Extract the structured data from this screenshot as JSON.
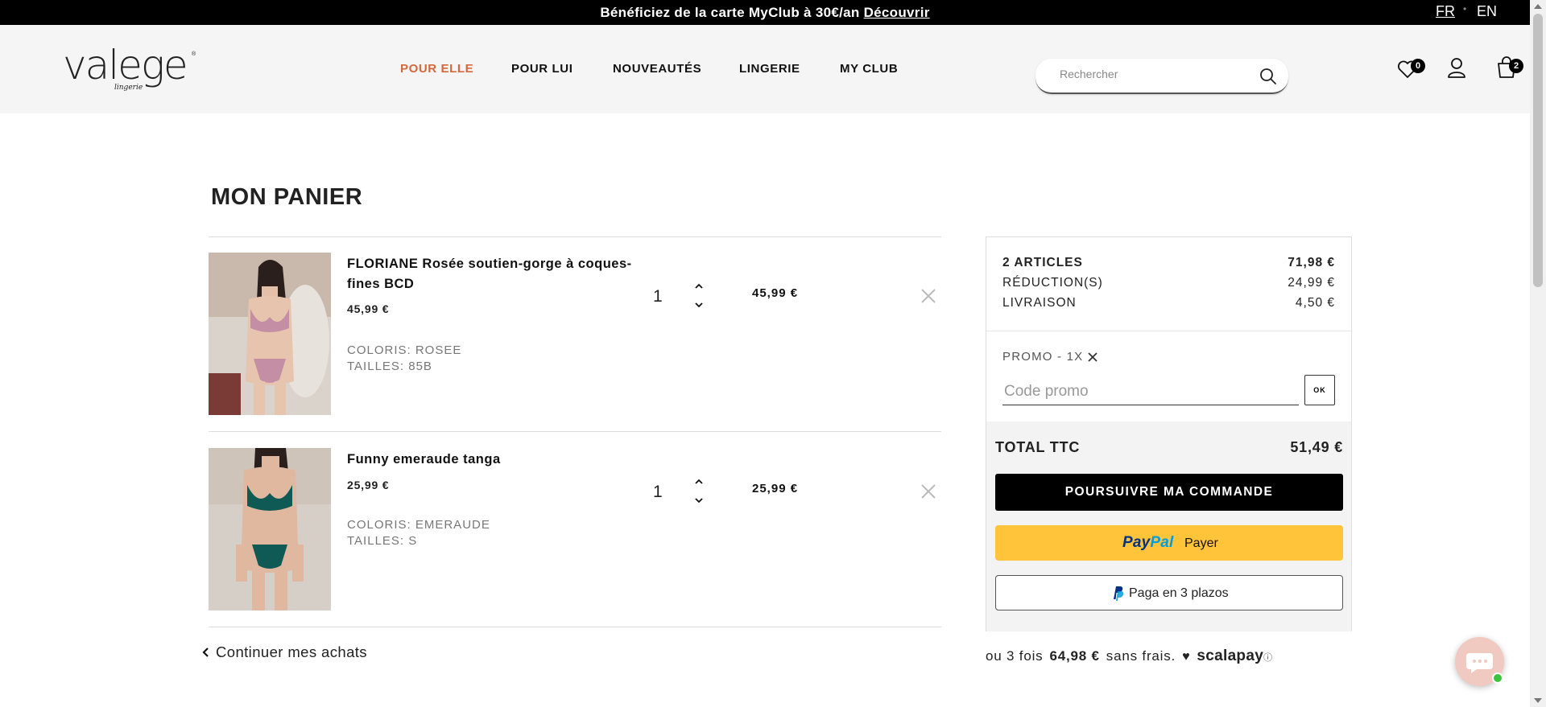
{
  "announcement": {
    "text": "Bénéficiez de la carte MyClub à 30€/an ",
    "link": "Découvrir"
  },
  "languages": {
    "fr": "FR",
    "en": "EN"
  },
  "logo": {
    "brand": "valege",
    "subtitle": "lingerie"
  },
  "nav": [
    "POUR ELLE",
    "POUR LUI",
    "NOUVEAUTÉS",
    "LINGERIE",
    "MY CLUB"
  ],
  "search": {
    "placeholder": "Rechercher"
  },
  "header_icons": {
    "wishlist_count": "0",
    "cart_count": "2"
  },
  "page_title": "MON PANIER",
  "cart_items": [
    {
      "name": "FLORIANE Rosée soutien-gorge à coques-fines BCD",
      "unit_price": "45,99 €",
      "color": "COLORIS: ROSEE",
      "size": "TAILLES: 85B",
      "qty": "1",
      "total": "45,99 €",
      "image_color": "#c48fa5"
    },
    {
      "name": "Funny emeraude tanga",
      "unit_price": "25,99 €",
      "color": "COLORIS: EMERAUDE",
      "size": "TAILLES: S",
      "qty": "1",
      "total": "25,99 €",
      "image_color": "#0f5a55"
    }
  ],
  "continue_label": "Continuer mes achats",
  "summary": {
    "articles_label": "2 ARTICLES",
    "articles_value": "71,98 €",
    "reduction_label": "RÉDUCTION(S)",
    "reduction_value": "24,99 €",
    "delivery_label": "LIVRAISON",
    "delivery_value": "4,50 €",
    "promo_applied": "PROMO - 1X",
    "promo_placeholder": "Code promo",
    "promo_ok": "OK",
    "total_label": "TOTAL TTC",
    "total_value": "51,49 €",
    "order_button": "POURSUIVRE MA COMMANDE",
    "paypal_brand_1": "Pay",
    "paypal_brand_2": "Pal",
    "paypal_label": "Payer",
    "paypal3_label": "Paga en 3 plazos"
  },
  "scalapay": {
    "prefix": "ou 3 fois",
    "amount": "64,98 €",
    "suffix": "sans frais.",
    "brand": "scalapay"
  },
  "colors": {
    "accent": "#d4683b",
    "paypal_yellow": "#ffc439",
    "black": "#000000"
  }
}
